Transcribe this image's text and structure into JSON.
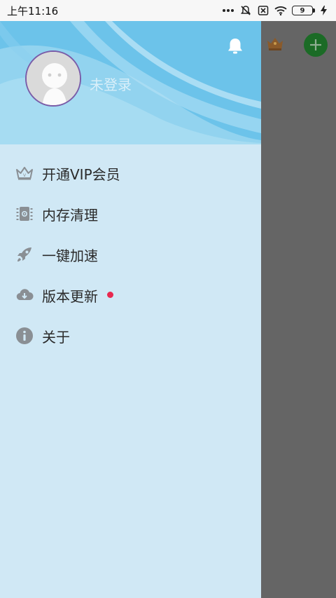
{
  "status_bar": {
    "time": "上午11:16",
    "battery_level": "9",
    "icons": [
      "more-dots-icon",
      "mute-icon",
      "sim-off-icon",
      "wifi-icon",
      "battery-icon",
      "charging-icon"
    ]
  },
  "drawer": {
    "user": {
      "login_status": "未登录"
    },
    "menu": [
      {
        "label": "开通VIP会员",
        "icon": "crown-icon"
      },
      {
        "label": "内存清理",
        "icon": "memory-chip-icon"
      },
      {
        "label": "一键加速",
        "icon": "rocket-icon"
      },
      {
        "label": "版本更新",
        "icon": "cloud-download-icon",
        "badge": "red-dot"
      },
      {
        "label": "关于",
        "icon": "info-icon"
      }
    ]
  },
  "colors": {
    "header_blue": "#74c8ec",
    "drawer_bg": "#d0e8f5",
    "scrim": "#656565",
    "add_button": "#1b6b26",
    "badge_red": "#e8294f",
    "icon_gray": "#8a8f94"
  }
}
